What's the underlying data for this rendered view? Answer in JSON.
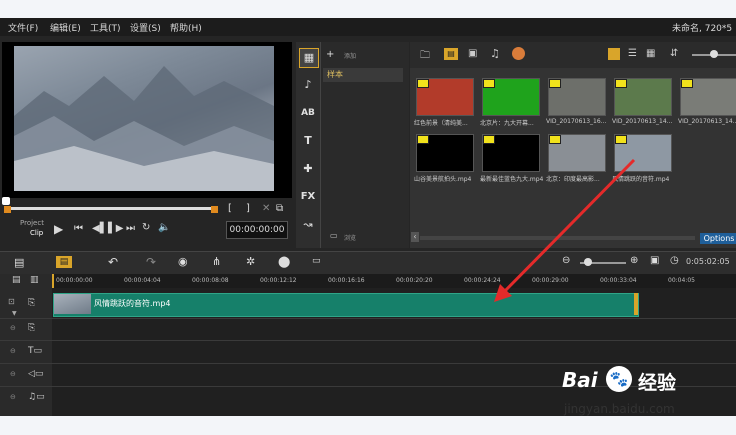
{
  "menu": [
    "文件(F)",
    "编辑(E)",
    "工具(T)",
    "设置(S)",
    "帮助(H)"
  ],
  "title_right": "未命名, 720*5",
  "player": {
    "project_label": "Project",
    "clip_label": "Clip",
    "timecode": "00:00:00:00"
  },
  "sidebar": {
    "add_label": "添加",
    "folder_label": "样本",
    "browse_label": "浏览"
  },
  "library": {
    "thumbs": [
      {
        "label": "红色前景（清纯美...",
        "color": "#b23b2a"
      },
      {
        "label": "北京片：九大开幕...",
        "color": "#1fa31c"
      },
      {
        "label": "VID_20170613_16...",
        "color": "#6d6f6a"
      },
      {
        "label": "VID_20170613_14...",
        "color": "#5c7a4c"
      },
      {
        "label": "VID_20170613_14...",
        "color": "#7a7c77"
      },
      {
        "label": "山谷美景航拍头.mp4",
        "color": "#000000"
      },
      {
        "label": "最新最佳蓝色九大.mp4",
        "color": "#000000"
      },
      {
        "label": "北京：印度最高影...",
        "color": "#8a8f95"
      },
      {
        "label": "风情跳跃的音符.mp4",
        "color": "#8e98a3"
      }
    ],
    "options_label": "Options"
  },
  "timeline": {
    "ruler": [
      "00:00:00:00",
      "00:00:04:04",
      "00:00:08:08",
      "00:00:12:12",
      "00:00:16:16",
      "00:00:20:20",
      "00:00:24:24",
      "00:00:29:00",
      "00:00:33:04",
      "00:04:05"
    ],
    "tc_right": "0:05:02:05",
    "clip_name": "风情跳跃的音符.mp4"
  },
  "watermark": {
    "brand": "Bai",
    "brand_tail": "经验",
    "url": "jingyan.baidu.com"
  }
}
